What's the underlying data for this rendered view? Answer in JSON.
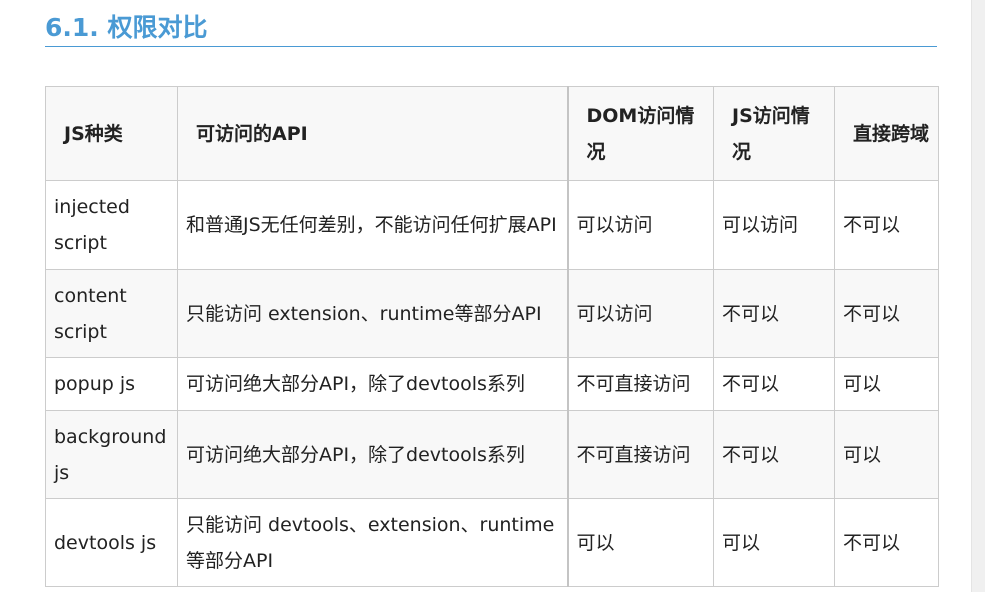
{
  "section": {
    "title": "6.1. 权限对比"
  },
  "table": {
    "headers": [
      "JS种类",
      "可访问的API",
      "DOM访问情况",
      "JS访问情况",
      "直接跨域"
    ],
    "rows": [
      [
        "injected script",
        "和普通JS无任何差别，不能访问任何扩展API",
        "可以访问",
        "可以访问",
        "不可以"
      ],
      [
        "content script",
        "只能访问 extension、runtime等部分API",
        "可以访问",
        "不可以",
        "不可以"
      ],
      [
        "popup js",
        "可访问绝大部分API，除了devtools系列",
        "不可直接访问",
        "不可以",
        "可以"
      ],
      [
        "background js",
        "可访问绝大部分API，除了devtools系列",
        "不可直接访问",
        "不可以",
        "可以"
      ],
      [
        "devtools js",
        "只能访问 devtools、extension、runtime等部分API",
        "可以",
        "可以",
        "不可以"
      ]
    ]
  }
}
